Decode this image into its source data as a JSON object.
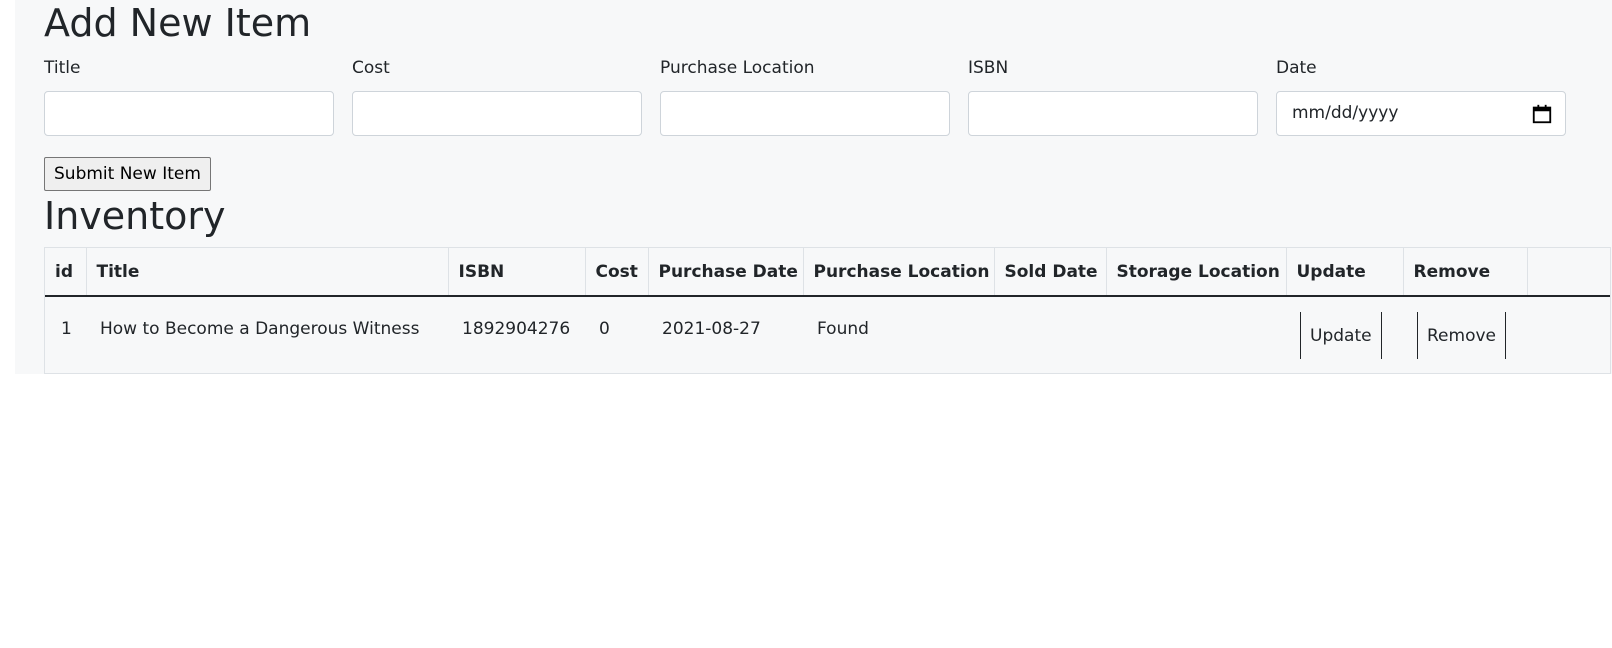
{
  "form": {
    "heading": "Add New Item",
    "fields": [
      {
        "label": "Title",
        "value": "",
        "placeholder": ""
      },
      {
        "label": "Cost",
        "value": "",
        "placeholder": ""
      },
      {
        "label": "Purchase Location",
        "value": "",
        "placeholder": ""
      },
      {
        "label": "ISBN",
        "value": "",
        "placeholder": ""
      },
      {
        "label": "Date",
        "value": "mm/dd/yyyy",
        "icon": "calendar-icon"
      }
    ],
    "submit_label": "Submit New Item"
  },
  "inventory": {
    "heading": "Inventory",
    "columns": [
      "id",
      "Title",
      "ISBN",
      "Cost",
      "Purchase Date",
      "Purchase Location",
      "Sold Date",
      "Storage Location",
      "Update",
      "Remove",
      ""
    ],
    "rows": [
      {
        "id": "1",
        "title": "How to Become a Dangerous Witness",
        "isbn": "1892904276",
        "cost": "0",
        "purchase_date": "2021-08-27",
        "purchase_location": "Found",
        "sold_date": "",
        "storage_location": "",
        "update_label": "Update",
        "remove_label": "Remove"
      }
    ]
  }
}
